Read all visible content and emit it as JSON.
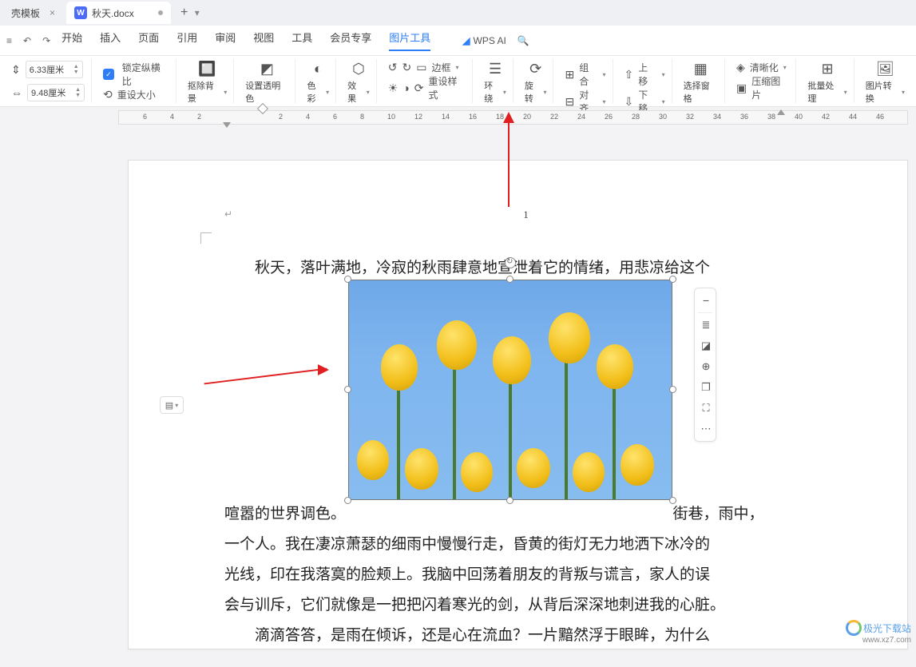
{
  "tabs": {
    "tab1_label": "壳模板",
    "tab2_label": "秋天.docx",
    "new": "+",
    "more": "▾"
  },
  "menu": {
    "items": [
      "开始",
      "插入",
      "页面",
      "引用",
      "审阅",
      "视图",
      "工具",
      "会员专享",
      "图片工具"
    ],
    "active_index": 8,
    "ai_label": "WPS AI"
  },
  "ribbon": {
    "width_value": "6.33厘米",
    "height_value": "9.48厘米",
    "lock_ratio": "锁定纵横比",
    "reset_size": "重设大小",
    "remove_bg": "抠除背景",
    "set_transparent": "设置透明色",
    "color": "色彩",
    "effect": "效果",
    "border": "边框",
    "reset_style": "重设样式",
    "wrap": "环绕",
    "rotate": "旋转",
    "group": "组合",
    "align": "对齐",
    "move_up": "上移",
    "move_down": "下移",
    "select_pane": "选择窗格",
    "clarity": "清晰化",
    "compress": "压缩图片",
    "batch": "批量处理",
    "convert": "图片转换"
  },
  "ruler_ticks": [
    "6",
    "4",
    "2",
    "2",
    "4",
    "6",
    "8",
    "10",
    "12",
    "14",
    "16",
    "18",
    "20",
    "22",
    "24",
    "26",
    "28",
    "30",
    "32",
    "34",
    "36",
    "38",
    "40",
    "42",
    "44",
    "46"
  ],
  "page": {
    "number": "1",
    "line1": "秋天，落叶满地，冷寂的秋雨肆意地宣泄着它的情绪，用悲凉给这个",
    "line2a": "喧嚣的世界调色。",
    "line2b": "街巷，雨中，",
    "line3": "一个人。我在凄凉萧瑟的细雨中慢慢行走，昏黄的街灯无力地洒下冰冷的",
    "line4": "光线，印在我落寞的脸颊上。我脑中回荡着朋友的背叛与谎言，家人的误",
    "line5": "会与训斥，它们就像是一把把闪着寒光的剑，从背后深深地刺进我的心脏。",
    "line6": "滴滴答答，是雨在倾诉，还是心在流血？一片黯然浮于眼眸，为什么"
  },
  "float_toolbar": {
    "items": [
      "minus-icon",
      "layout-icon",
      "crop-icon",
      "zoom-icon",
      "copy-icon",
      "expand-icon",
      "more-icon"
    ]
  },
  "watermark": {
    "name": "极光下载站",
    "url": "www.xz7.com"
  }
}
